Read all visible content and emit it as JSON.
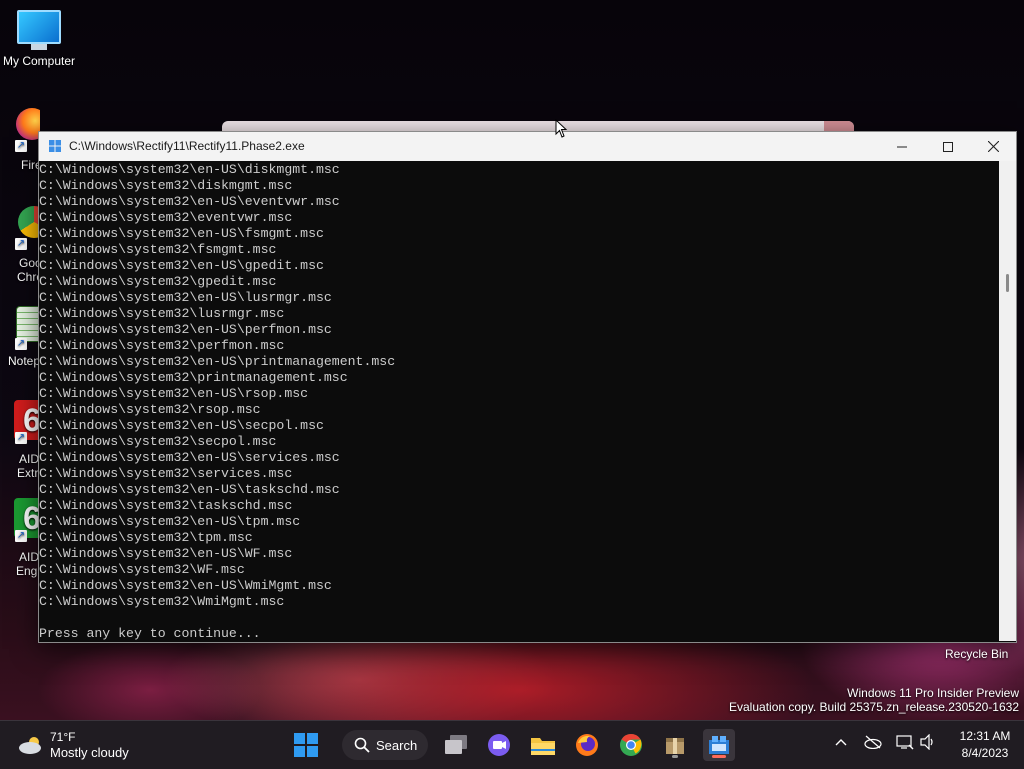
{
  "desktop": {
    "icons": [
      {
        "label": "My Computer"
      },
      {
        "label": "Fire"
      },
      {
        "label": "Goo"
      },
      {
        "label": "Chro"
      },
      {
        "label": "Notep"
      },
      {
        "label": "AID"
      },
      {
        "label": "Extr"
      },
      {
        "label": "AID"
      },
      {
        "label": "Engi"
      }
    ],
    "recycle_bin": "Recycle Bin"
  },
  "console": {
    "title": "C:\\Windows\\Rectify11\\Rectify11.Phase2.exe",
    "lines": [
      "C:\\Windows\\system32\\en-US\\diskmgmt.msc",
      "C:\\Windows\\system32\\diskmgmt.msc",
      "C:\\Windows\\system32\\en-US\\eventvwr.msc",
      "C:\\Windows\\system32\\eventvwr.msc",
      "C:\\Windows\\system32\\en-US\\fsmgmt.msc",
      "C:\\Windows\\system32\\fsmgmt.msc",
      "C:\\Windows\\system32\\en-US\\gpedit.msc",
      "C:\\Windows\\system32\\gpedit.msc",
      "C:\\Windows\\system32\\en-US\\lusrmgr.msc",
      "C:\\Windows\\system32\\lusrmgr.msc",
      "C:\\Windows\\system32\\en-US\\perfmon.msc",
      "C:\\Windows\\system32\\perfmon.msc",
      "C:\\Windows\\system32\\en-US\\printmanagement.msc",
      "C:\\Windows\\system32\\printmanagement.msc",
      "C:\\Windows\\system32\\en-US\\rsop.msc",
      "C:\\Windows\\system32\\rsop.msc",
      "C:\\Windows\\system32\\en-US\\secpol.msc",
      "C:\\Windows\\system32\\secpol.msc",
      "C:\\Windows\\system32\\en-US\\services.msc",
      "C:\\Windows\\system32\\services.msc",
      "C:\\Windows\\system32\\en-US\\taskschd.msc",
      "C:\\Windows\\system32\\taskschd.msc",
      "C:\\Windows\\system32\\en-US\\tpm.msc",
      "C:\\Windows\\system32\\tpm.msc",
      "C:\\Windows\\system32\\en-US\\WF.msc",
      "C:\\Windows\\system32\\WF.msc",
      "C:\\Windows\\system32\\en-US\\WmiMgmt.msc",
      "C:\\Windows\\system32\\WmiMgmt.msc",
      "",
      "Press any key to continue..."
    ],
    "controls": {
      "minimize": "—",
      "maximize": "☐",
      "close": "✕"
    }
  },
  "watermark": {
    "line1": "Windows 11 Pro Insider Preview",
    "line2": "Evaluation copy. Build 25375.zn_release.230520-1632"
  },
  "taskbar": {
    "weather": {
      "temp": "71°F",
      "condition": "Mostly cloudy"
    },
    "search_label": "Search",
    "clock": {
      "time": "12:31 AM",
      "date": "8/4/2023"
    }
  },
  "colors": {
    "console_bg": "#0c0c0c",
    "console_text": "#cccccc",
    "taskbar_bg": "#201c22",
    "accent": "#0a84ff"
  }
}
